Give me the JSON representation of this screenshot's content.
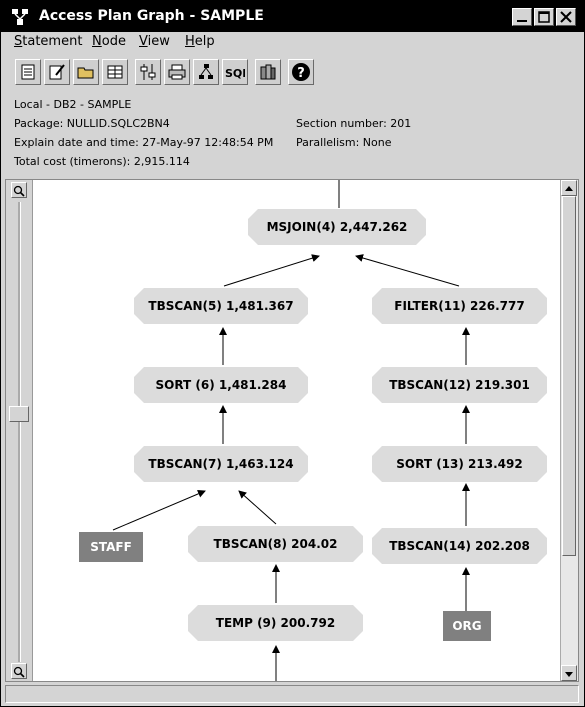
{
  "window": {
    "title": "Access Plan Graph - SAMPLE"
  },
  "menu": [
    {
      "mnemonic": "S",
      "rest": "tatement"
    },
    {
      "mnemonic": "N",
      "rest": "ode"
    },
    {
      "mnemonic": "V",
      "rest": "iew"
    },
    {
      "mnemonic": "H",
      "rest": "elp"
    }
  ],
  "toolbar": {
    "sql_label": "SQL",
    "help_label": "?"
  },
  "info": {
    "location": "Local - DB2 - SAMPLE",
    "package": "Package: NULLID.SQLC2BN4",
    "section": "Section number: 201",
    "explain": "Explain date and time: 27-May-97 12:48:54 PM",
    "parallelism": "Parallelism: None",
    "total_cost": "Total cost (timerons): 2,915.114"
  },
  "graph": {
    "nodes": {
      "msjoin": "MSJOIN(4) 2,447.262",
      "tbscan5": "TBSCAN(5) 1,481.367",
      "filter11": "FILTER(11) 226.777",
      "sort6": "SORT (6) 1,481.284",
      "tbscan12": "TBSCAN(12) 219.301",
      "tbscan7": "TBSCAN(7) 1,463.124",
      "sort13": "SORT (13) 213.492",
      "staff": "STAFF",
      "tbscan8": "TBSCAN(8) 204.02",
      "tbscan14": "TBSCAN(14) 202.208",
      "temp9": "TEMP (9) 200.792",
      "org": "ORG"
    }
  },
  "colors": {
    "node_fill": "#dcdcdc",
    "table_fill": "#808080",
    "titlebar": "#000000"
  }
}
